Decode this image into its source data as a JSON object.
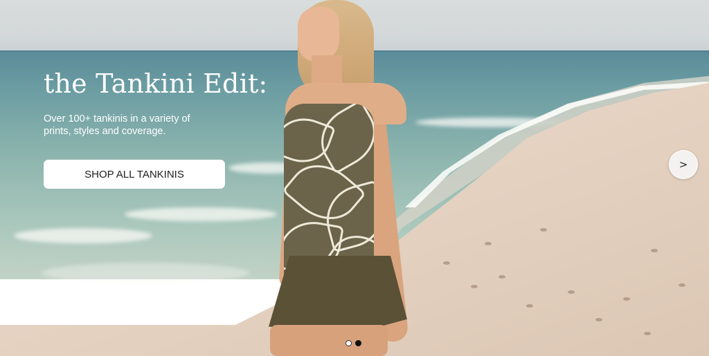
{
  "hero": {
    "headline": "the Tankini Edit:",
    "subtext": "Over 100+ tankinis in a variety of prints, styles and coverage.",
    "cta_label": "SHOP ALL TANKINIS",
    "next_icon": "chevron-right-icon",
    "next_glyph": ">",
    "image_subject": "model-on-beach-photo"
  },
  "carousel": {
    "slide_count": 2,
    "active_slide": 2
  },
  "colors": {
    "text": "#ffffff",
    "button_bg": "#ffffff",
    "button_text": "#1d1d1d",
    "dot_active": "#111111"
  }
}
